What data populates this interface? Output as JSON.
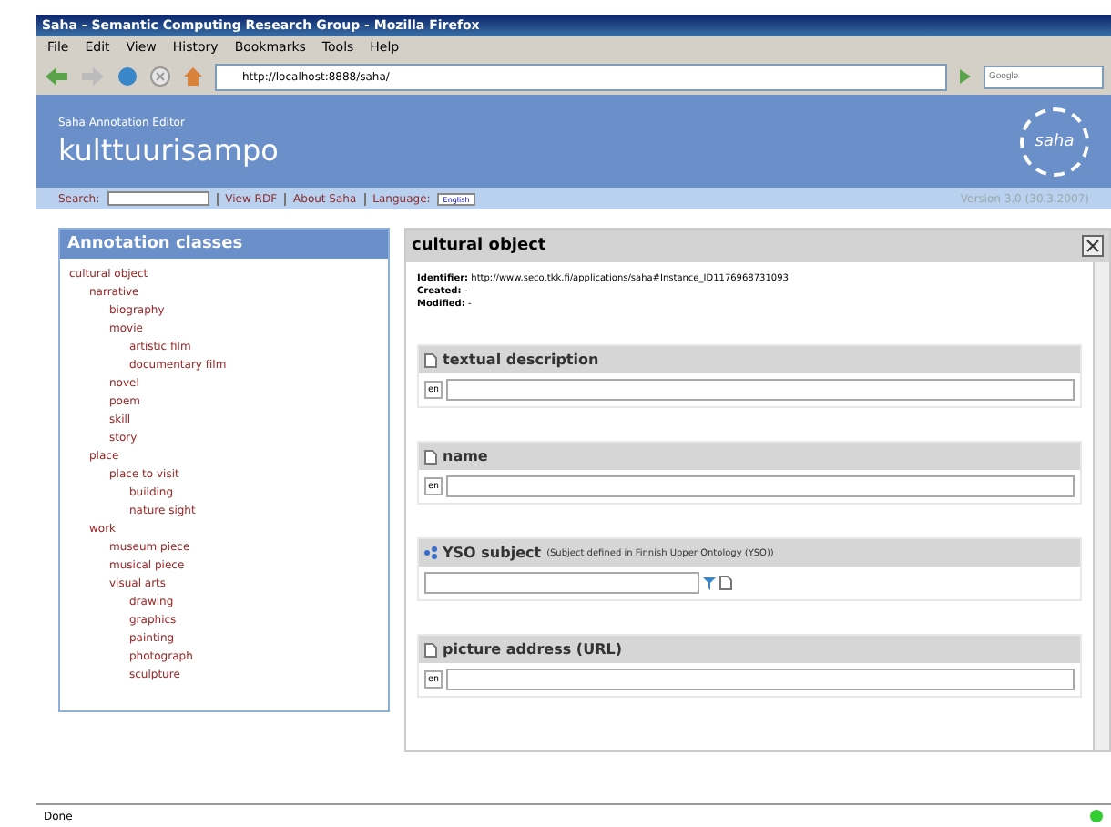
{
  "window": {
    "title": "Saha - Semantic Computing Research Group - Mozilla Firefox"
  },
  "menu": [
    "File",
    "Edit",
    "View",
    "History",
    "Bookmarks",
    "Tools",
    "Help"
  ],
  "address": "http://localhost:8888/saha/",
  "search_engine": {
    "placeholder": "Google"
  },
  "header": {
    "subtitle": "Saha Annotation Editor",
    "title": "kulttuurisampo",
    "logo": "saha"
  },
  "linkbar": {
    "search_label": "Search:",
    "links": [
      "View RDF",
      "About Saha"
    ],
    "language_label": "Language:",
    "language": "English",
    "version": "Version 3.0 (30.3.2007)"
  },
  "classes": {
    "title": "Annotation classes",
    "tree": [
      {
        "label": "cultural object",
        "children": [
          {
            "label": "narrative",
            "children": [
              {
                "label": "biography"
              },
              {
                "label": "movie",
                "children": [
                  {
                    "label": "artistic film"
                  },
                  {
                    "label": "documentary film"
                  }
                ]
              },
              {
                "label": "novel"
              },
              {
                "label": "poem"
              },
              {
                "label": "skill"
              },
              {
                "label": "story"
              }
            ]
          },
          {
            "label": "place",
            "children": [
              {
                "label": "place to visit",
                "children": [
                  {
                    "label": "building"
                  },
                  {
                    "label": "nature sight"
                  }
                ]
              }
            ]
          },
          {
            "label": "work",
            "children": [
              {
                "label": "museum piece"
              },
              {
                "label": "musical piece"
              },
              {
                "label": "visual arts",
                "children": [
                  {
                    "label": "drawing"
                  },
                  {
                    "label": "graphics"
                  },
                  {
                    "label": "painting"
                  },
                  {
                    "label": "photograph"
                  },
                  {
                    "label": "sculpture"
                  }
                ]
              }
            ]
          }
        ]
      }
    ]
  },
  "instance": {
    "title": "cultural object",
    "meta": [
      "**Identifier:** http://www.seco.tkk.fi/applications/saha#Instance_ID1176968731093",
      "**Created:** -",
      "**Modified:** -"
    ],
    "properties": [
      {
        "kind": "text",
        "name": "textual description",
        "lang": "en"
      },
      {
        "kind": "text",
        "name": "name",
        "lang": "en"
      },
      {
        "kind": "resource",
        "name": "YSO subject",
        "note": "(Subject defined in Finnish Upper Ontology (YSO))"
      },
      {
        "kind": "text",
        "name": "picture address (URL)",
        "lang": "en"
      }
    ]
  },
  "status_bar": {
    "text": "Done"
  }
}
